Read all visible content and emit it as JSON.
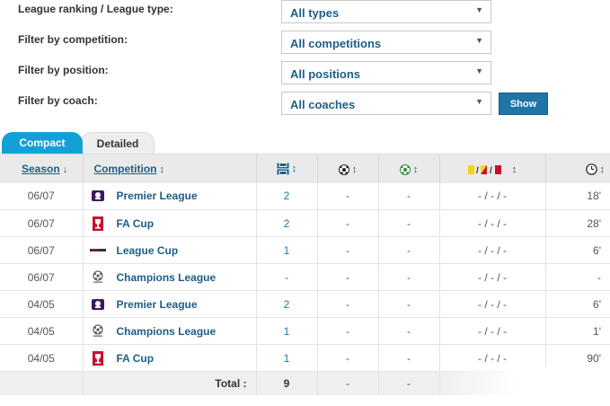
{
  "filters": [
    {
      "label": "League ranking / League type:",
      "value": "All types"
    },
    {
      "label": "Filter by competition:",
      "value": "All competitions"
    },
    {
      "label": "Filter by position:",
      "value": "All positions"
    },
    {
      "label": "Filter by coach:",
      "value": "All coaches"
    }
  ],
  "show_button": "Show",
  "tabs": {
    "compact": "Compact",
    "detailed": "Detailed"
  },
  "headers": {
    "season": "Season",
    "competition": "Competition",
    "sort_arrow": "↓",
    "sort_both": "↕"
  },
  "rows": [
    {
      "season": "06/07",
      "logo": "premier-league-logo",
      "competition": "Premier League",
      "apps": "2",
      "goals": "-",
      "assists": "-",
      "cards": "- / - / -",
      "minutes": "18'"
    },
    {
      "season": "06/07",
      "logo": "fa-cup-logo",
      "competition": "FA Cup",
      "apps": "2",
      "goals": "-",
      "assists": "-",
      "cards": "- / - / -",
      "minutes": "28'"
    },
    {
      "season": "06/07",
      "logo": "league-cup-logo",
      "competition": "League Cup",
      "apps": "1",
      "goals": "-",
      "assists": "-",
      "cards": "- / - / -",
      "minutes": "6'"
    },
    {
      "season": "06/07",
      "logo": "champions-league-logo",
      "competition": "Champions League",
      "apps": "-",
      "goals": "-",
      "assists": "-",
      "cards": "- / - / -",
      "minutes": "-"
    },
    {
      "season": "04/05",
      "logo": "premier-league-logo",
      "competition": "Premier League",
      "apps": "2",
      "goals": "-",
      "assists": "-",
      "cards": "- / - / -",
      "minutes": "6'"
    },
    {
      "season": "04/05",
      "logo": "champions-league-logo",
      "competition": "Champions League",
      "apps": "1",
      "goals": "-",
      "assists": "-",
      "cards": "- / - / -",
      "minutes": "1'"
    },
    {
      "season": "04/05",
      "logo": "fa-cup-logo",
      "competition": "FA Cup",
      "apps": "1",
      "goals": "-",
      "assists": "-",
      "cards": "- / - / -",
      "minutes": "90'"
    }
  ],
  "total": {
    "label": "Total :",
    "apps": "9",
    "goals": "-",
    "assists": "-"
  },
  "colors": {
    "accent_blue": "#13a0d6",
    "link_blue": "#1d5f86",
    "button_blue": "#1d75a8",
    "yellow_card": "#f5d31a",
    "red_card": "#c8102e"
  }
}
